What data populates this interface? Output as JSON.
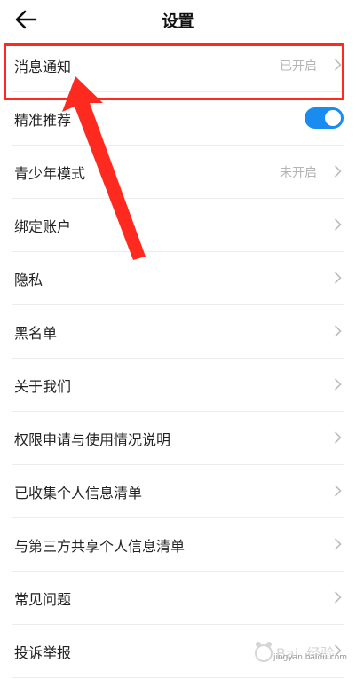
{
  "header": {
    "title": "设置"
  },
  "settings": {
    "items": [
      {
        "label": "消息通知",
        "value": "已开启"
      },
      {
        "label": "精准推荐",
        "toggle": true
      },
      {
        "label": "青少年模式",
        "value": "未开启"
      },
      {
        "label": "绑定账户"
      },
      {
        "label": "隐私"
      },
      {
        "label": "黑名单"
      },
      {
        "label": "关于我们"
      },
      {
        "label": "权限申请与使用情况说明"
      },
      {
        "label": "已收集个人信息清单"
      },
      {
        "label": "与第三方共享个人信息清单"
      },
      {
        "label": "常见问题"
      },
      {
        "label": "投诉举报"
      }
    ]
  },
  "colors": {
    "accent": "#1a8cf0",
    "annotation": "#ff2a1f"
  },
  "watermark": {
    "text": "jingyan.baidu.com"
  }
}
